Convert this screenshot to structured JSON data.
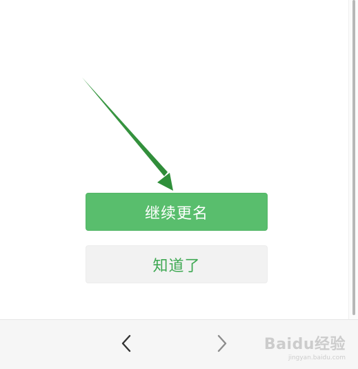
{
  "dialog": {
    "primary_button_label": "继续更名",
    "secondary_button_label": "知道了"
  },
  "bottom_bar": {
    "back_icon": "chevron-left-icon",
    "forward_icon": "chevron-right-icon"
  },
  "watermark": {
    "main_text": "Baidu经验",
    "sub_text": "jingyan.baidu.com"
  },
  "colors": {
    "primary_button_bg": "#59be6d",
    "primary_button_text": "#ffffff",
    "secondary_button_bg": "#f2f2f2",
    "secondary_button_text": "#3ea852",
    "annotation_arrow": "#2f8f3a"
  }
}
